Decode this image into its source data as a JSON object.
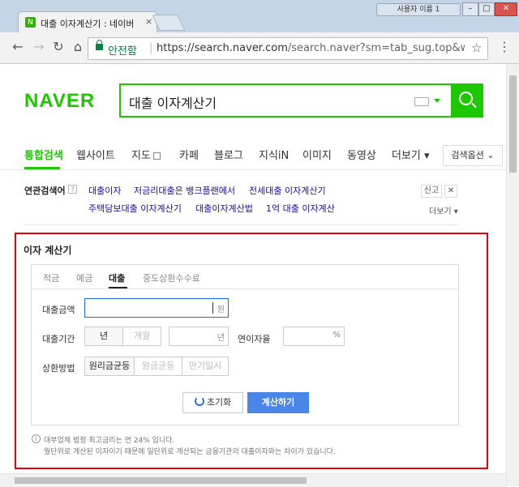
{
  "window": {
    "user_label": "사용자 이름 1",
    "minimize": "–",
    "maximize": "□",
    "close": "✕"
  },
  "tab": {
    "favicon": "N",
    "title": "대출 이자계산기 : 네이버",
    "close": "×"
  },
  "toolbar": {
    "back": "←",
    "forward": "→",
    "reload": "↻",
    "home": "⌂",
    "secure_label": "안전함",
    "url_host": "https://search.naver.com",
    "url_rest": "/search.naver?sm=tab_sug.top&where=n...",
    "star": "☆",
    "menu": "⋮"
  },
  "header": {
    "logo": "NAVER",
    "query": "대출 이자계산기"
  },
  "nav": {
    "items": [
      "통합검색",
      "웹사이트",
      "지도",
      "카페",
      "블로그",
      "지식iN",
      "이미지",
      "동영상",
      "더보기"
    ],
    "more_caret": "▾",
    "options": "검색옵션",
    "options_caret": "⌄"
  },
  "related": {
    "title": "연관검색어",
    "help": "?",
    "links": [
      "대출이자",
      "저금리대출은 뱅크플랜에서",
      "전세대출 이자계산기",
      "주택담보대출 이자계산기",
      "대출이자계산법",
      "1억 대출 이자계산"
    ],
    "report": "신고",
    "close": "✕",
    "more": "더보기"
  },
  "calculator": {
    "title": "이자 계산기",
    "tabs": [
      "적금",
      "예금",
      "대출",
      "중도상환수수료"
    ],
    "active_tab": "대출",
    "amount_label": "대출금액",
    "amount_value": "",
    "amount_unit": "원",
    "period_label": "대출기간",
    "period_unit_year": "년",
    "period_unit_month": "개월",
    "period_input_unit": "년",
    "rate_label": "연이자율",
    "rate_unit": "%",
    "repay_label": "상환방법",
    "repay_options": [
      "원리금균등",
      "원금균등",
      "만기일시"
    ],
    "repay_selected": "원리금균등",
    "reset_label": "초기화",
    "calc_label": "계산하기",
    "info_icon": "i",
    "note_line1": "대부업체 법정 최고금리는 연 24% 입니다.",
    "note_line2": "월단위로 계산된 이자이기 때문에 일단위로 계산되는 금융기관의 대출이자와는 차이가 있습니다."
  },
  "colors": {
    "naver_green": "#1ec800",
    "link_blue": "#1a0dab",
    "highlight_red": "#e8000d",
    "button_blue": "#4a86e8"
  }
}
